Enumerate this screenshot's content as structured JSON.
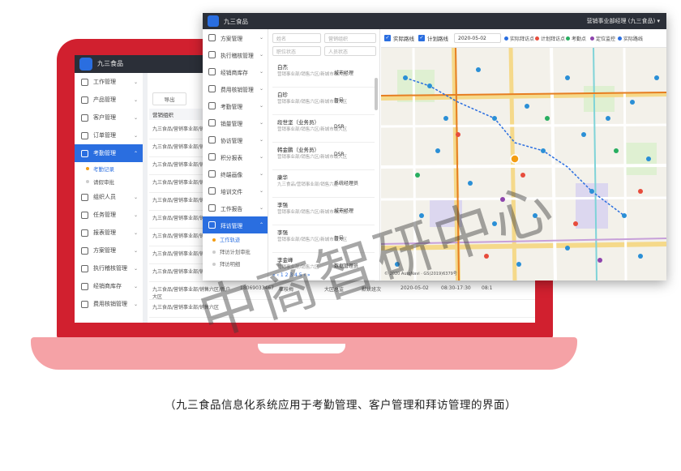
{
  "caption": "（九三食品信息化系统应用于考勤管理、客户管理和拜访管理的界面）",
  "watermark": "中商智研中心",
  "back_app": {
    "title": "九三食品",
    "sidebar": [
      {
        "label": "工作管理"
      },
      {
        "label": "产品管理"
      },
      {
        "label": "客户管理"
      },
      {
        "label": "订单管理"
      },
      {
        "label": "考勤管理",
        "active": true
      },
      {
        "sub": true,
        "label": "考勤记录",
        "current": true
      },
      {
        "sub": true,
        "label": "请假审批"
      },
      {
        "label": "组织人员"
      },
      {
        "label": "任务管理"
      },
      {
        "label": "报表管理"
      },
      {
        "label": "方案管理"
      },
      {
        "label": "执行稽核管理"
      },
      {
        "label": "经销商库存"
      },
      {
        "label": "费用核销管理"
      }
    ],
    "nav_btn": "导出",
    "table_header": "营销组织",
    "rows": [
      {
        "org": "九三食品/营销事业部/销售六区/大区"
      },
      {
        "org": "九三食品/营销事业部/销售六区/大区"
      },
      {
        "org": "九三食品/营销事业部/销售六区/大区"
      },
      {
        "org": "九三食品/营销事业部/销售六区/大区"
      },
      {
        "org": "九三食品/营销事业部/销售六区/大区"
      },
      {
        "org": "九三食品/营销事业部/销售六区/大区"
      },
      {
        "org": "九三食品/营销事业部/销售六区/大区"
      },
      {
        "org": "九三食品/营销事业部/销售六区/大区"
      },
      {
        "org": "九三食品/营销事业部/销售六区/大区"
      },
      {
        "org": "九三食品/营销事业部/销售六区/新户大区",
        "phone": "18069033467",
        "name": "崔枝梅",
        "area": "大区总监",
        "type": "默认班次",
        "date": "2020-05-02",
        "time": "08:30-17:30",
        "extra": "08:1"
      },
      {
        "org": "九三食品/营销事业部/销售六区"
      }
    ]
  },
  "front_app": {
    "title": "九三食品",
    "user": "营销事业部经理 (九三食品) ▾",
    "sidebar": [
      {
        "label": "方案管理"
      },
      {
        "label": "执行稽核管理"
      },
      {
        "label": "经销商库存"
      },
      {
        "label": "费用核销管理"
      },
      {
        "label": "考勤管理"
      },
      {
        "label": "销量管理"
      },
      {
        "label": "协访管理"
      },
      {
        "label": "积分报表"
      },
      {
        "label": "终端画像"
      },
      {
        "label": "培训文件"
      },
      {
        "label": "工作报告"
      },
      {
        "label": "拜访管理",
        "active": true
      },
      {
        "sub": true,
        "label": "工作轨迹",
        "current": true
      },
      {
        "sub": true,
        "label": "拜访计划审批"
      },
      {
        "sub": true,
        "label": "拜访明细"
      }
    ],
    "filters": {
      "name_placeholder": "姓名",
      "org_placeholder": "营销组织",
      "role_placeholder": "职位状态",
      "status_placeholder": "人员状态"
    },
    "people": [
      {
        "name": "白杰",
        "dept": "营销事业部/销售六区/新城市级大区",
        "role": "城市经理"
      },
      {
        "name": "白珍",
        "dept": "营销事业部/销售六区/新城市级大区",
        "role": "督导"
      },
      {
        "name": "段世坚（业务员）",
        "dept": "营销事业部/销售六区/新城市级大区",
        "role": "DSR"
      },
      {
        "name": "韩金鹏（业务员）",
        "dept": "营销事业部/销售六区/新城市级大区",
        "role": "DSR"
      },
      {
        "name": "康华",
        "dept": "九三食品/营销事业部/销售六区",
        "role": "系统经理员"
      },
      {
        "name": "李强",
        "dept": "营销事业部/销售六区/新城市级大区",
        "role": "城市经理"
      },
      {
        "name": "李强",
        "dept": "营销事业部/销售六区/新城市级大区",
        "role": "督导"
      },
      {
        "name": "李金峰",
        "dept": "营销事业部/销售六区",
        "role": "数据管理员"
      }
    ],
    "pager": "« ‹ 1 2 3 4 5 › »",
    "toolbar": {
      "actual_route": "实际路线",
      "plan_route": "计划路线",
      "date": "2020-05-02",
      "legend": [
        {
          "label": "实际拜访点",
          "color": "#2a6ee0"
        },
        {
          "label": "计划拜访点",
          "color": "#e74c3c"
        },
        {
          "label": "考勤点",
          "color": "#27ae60"
        },
        {
          "label": "定位监控",
          "color": "#8e44ad"
        },
        {
          "label": "实际路线",
          "color": "#2a6ee0"
        }
      ]
    },
    "map_copyright": "© 2020 AutoNavi · GS(2019)6379号"
  }
}
